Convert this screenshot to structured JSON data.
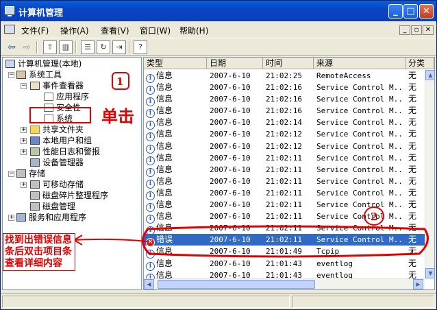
{
  "window": {
    "title": "计算机管理"
  },
  "menubar": {
    "items": [
      "文件(F)",
      "操作(A)",
      "查看(V)",
      "窗口(W)",
      "帮助(H)"
    ]
  },
  "tree": {
    "root": "计算机管理(本地)",
    "system_tools": "系统工具",
    "event_viewer": "事件查看器",
    "logs": [
      "应用程序",
      "安全性",
      "系统"
    ],
    "shared_folders": "共享文件夹",
    "local_users": "本地用户和组",
    "perf_logs": "性能日志和警报",
    "device_manager": "设备管理器",
    "storage": "存储",
    "removable": "可移动存储",
    "defrag": "磁盘碎片整理程序",
    "disk_mgmt": "磁盘管理",
    "services": "服务和应用程序"
  },
  "grid": {
    "headers": [
      "类型",
      "日期",
      "时间",
      "来源",
      "分类"
    ],
    "rows": [
      {
        "type": "信息",
        "date": "2007-6-10",
        "time": "21:02:25",
        "source": "RemoteAccess",
        "category": "无"
      },
      {
        "type": "信息",
        "date": "2007-6-10",
        "time": "21:02:16",
        "source": "Service Control M...",
        "category": "无"
      },
      {
        "type": "信息",
        "date": "2007-6-10",
        "time": "21:02:16",
        "source": "Service Control M...",
        "category": "无"
      },
      {
        "type": "信息",
        "date": "2007-6-10",
        "time": "21:02:16",
        "source": "Service Control M...",
        "category": "无"
      },
      {
        "type": "信息",
        "date": "2007-6-10",
        "time": "21:02:14",
        "source": "Service Control M...",
        "category": "无"
      },
      {
        "type": "信息",
        "date": "2007-6-10",
        "time": "21:02:12",
        "source": "Service Control M...",
        "category": "无"
      },
      {
        "type": "信息",
        "date": "2007-6-10",
        "time": "21:02:12",
        "source": "Service Control M...",
        "category": "无"
      },
      {
        "type": "信息",
        "date": "2007-6-10",
        "time": "21:02:11",
        "source": "Service Control M...",
        "category": "无"
      },
      {
        "type": "信息",
        "date": "2007-6-10",
        "time": "21:02:11",
        "source": "Service Control M...",
        "category": "无"
      },
      {
        "type": "信息",
        "date": "2007-6-10",
        "time": "21:02:11",
        "source": "Service Control M...",
        "category": "无"
      },
      {
        "type": "信息",
        "date": "2007-6-10",
        "time": "21:02:11",
        "source": "Service Control M...",
        "category": "无"
      },
      {
        "type": "信息",
        "date": "2007-6-10",
        "time": "21:02:11",
        "source": "Service Control M...",
        "category": "无"
      },
      {
        "type": "信息",
        "date": "2007-6-10",
        "time": "21:02:11",
        "source": "Service Control M...",
        "category": "无"
      },
      {
        "type": "信息",
        "date": "2007-6-10",
        "time": "21:02:11",
        "source": "Service Control M...",
        "category": "无"
      },
      {
        "type": "错误",
        "date": "2007-6-10",
        "time": "21:02:11",
        "source": "Service Control M...",
        "category": "无",
        "selected": true
      },
      {
        "type": "信息",
        "date": "2007-6-10",
        "time": "21:01:49",
        "source": "Tcpip",
        "category": "无"
      },
      {
        "type": "信息",
        "date": "2007-6-10",
        "time": "21:01:43",
        "source": "eventlog",
        "category": "无"
      },
      {
        "type": "信息",
        "date": "2007-6-10",
        "time": "21:01:43",
        "source": "eventlog",
        "category": "无"
      }
    ]
  },
  "annotations": {
    "step1_mark": "1",
    "step1_text": "单击",
    "step2_mark": "2",
    "instruction": "找到出错误信息条后双击项目条查看详细内容"
  },
  "colors": {
    "annotation_red": "#e00000",
    "selection_blue": "#316ac5",
    "title_blue": "#0a5fd8"
  }
}
